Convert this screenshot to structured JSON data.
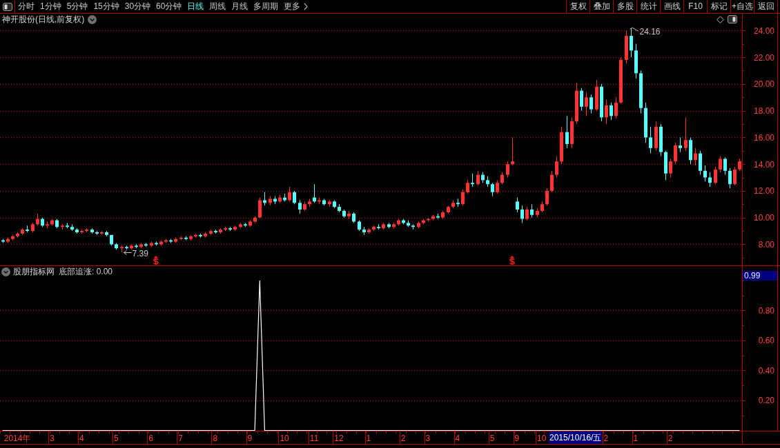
{
  "toolbar": {
    "period_tabs": [
      {
        "label": "分时",
        "selected": false
      },
      {
        "label": "1分钟",
        "selected": false
      },
      {
        "label": "5分钟",
        "selected": false
      },
      {
        "label": "15分钟",
        "selected": false
      },
      {
        "label": "30分钟",
        "selected": false
      },
      {
        "label": "60分钟",
        "selected": false
      },
      {
        "label": "日线",
        "selected": true
      },
      {
        "label": "周线",
        "selected": false
      },
      {
        "label": "月线",
        "selected": false
      },
      {
        "label": "多周期",
        "selected": false
      }
    ],
    "more_button": {
      "label": "更多"
    },
    "buttons": [
      "复权",
      "叠加",
      "多股",
      "统计",
      "画线",
      "F10",
      "标记",
      "+自选",
      "返回"
    ]
  },
  "chart": {
    "price_title": "神开股份(日线,前复权)",
    "indicator_name": "股朋指标网",
    "indicator_readout": "底部追涨: 0.00",
    "cursor_value": "0.99",
    "cursor_date": "2015/10/16/五",
    "chart_data": [
      {
        "type": "candlestick",
        "grid": true,
        "ylim": [
          6.45,
          24.4
        ],
        "yticks": [
          {
            "value": 8,
            "label": "8.00"
          },
          {
            "value": 10,
            "label": "10.00"
          },
          {
            "value": 12,
            "label": "12.00"
          },
          {
            "value": 14,
            "label": "14.00"
          },
          {
            "value": 16,
            "label": "16.00"
          },
          {
            "value": 18,
            "label": "18.00"
          },
          {
            "value": 20,
            "label": "20.00"
          },
          {
            "value": 22,
            "label": "22.00"
          },
          {
            "value": 24,
            "label": "24.00"
          }
        ],
        "ohlc": [
          [
            8.3,
            8.4,
            8.1,
            8.2
          ],
          [
            8.2,
            8.5,
            8.1,
            8.4
          ],
          [
            8.4,
            8.7,
            8.3,
            8.6
          ],
          [
            8.6,
            8.9,
            8.5,
            8.8
          ],
          [
            8.8,
            9.2,
            8.7,
            9.1
          ],
          [
            9.1,
            9.4,
            8.9,
            9.0
          ],
          [
            9.0,
            9.6,
            8.9,
            9.5
          ],
          [
            9.5,
            10.3,
            9.4,
            9.9
          ],
          [
            9.9,
            10.0,
            9.3,
            9.4
          ],
          [
            9.4,
            9.7,
            9.2,
            9.5
          ],
          [
            9.5,
            9.9,
            9.4,
            9.8
          ],
          [
            9.8,
            9.9,
            9.2,
            9.3
          ],
          [
            9.3,
            9.5,
            9.1,
            9.4
          ],
          [
            9.4,
            9.6,
            9.2,
            9.3
          ],
          [
            9.3,
            9.5,
            9.0,
            9.1
          ],
          [
            9.1,
            9.2,
            8.8,
            8.9
          ],
          [
            8.9,
            9.1,
            8.8,
            9.0
          ],
          [
            9.0,
            9.2,
            8.9,
            9.1
          ],
          [
            9.1,
            9.2,
            8.8,
            8.9
          ],
          [
            8.9,
            9.0,
            8.7,
            8.8
          ],
          [
            8.8,
            9.0,
            8.7,
            8.9
          ],
          [
            8.9,
            9.0,
            8.6,
            8.7
          ],
          [
            8.7,
            8.7,
            7.9,
            8.0
          ],
          [
            8.0,
            8.1,
            7.6,
            7.7
          ],
          [
            7.7,
            7.9,
            7.39,
            7.8
          ],
          [
            7.8,
            7.9,
            7.6,
            7.7
          ],
          [
            7.7,
            8.0,
            7.6,
            7.9
          ],
          [
            7.9,
            8.0,
            7.7,
            7.8
          ],
          [
            7.8,
            8.1,
            7.7,
            8.0
          ],
          [
            8.0,
            8.1,
            7.8,
            7.9
          ],
          [
            7.9,
            8.2,
            7.8,
            8.1
          ],
          [
            8.1,
            8.2,
            7.9,
            8.0
          ],
          [
            8.0,
            8.3,
            7.9,
            8.2
          ],
          [
            8.2,
            8.4,
            8.1,
            8.3
          ],
          [
            8.3,
            8.4,
            8.1,
            8.2
          ],
          [
            8.2,
            8.5,
            8.1,
            8.4
          ],
          [
            8.4,
            8.6,
            8.3,
            8.5
          ],
          [
            8.5,
            8.6,
            8.3,
            8.4
          ],
          [
            8.4,
            8.7,
            8.3,
            8.6
          ],
          [
            8.6,
            8.8,
            8.5,
            8.7
          ],
          [
            8.7,
            8.8,
            8.5,
            8.6
          ],
          [
            8.6,
            8.9,
            8.5,
            8.8
          ],
          [
            8.8,
            9.1,
            8.7,
            9.0
          ],
          [
            9.0,
            9.1,
            8.8,
            8.9
          ],
          [
            8.9,
            9.2,
            8.8,
            9.1
          ],
          [
            9.1,
            9.3,
            9.0,
            9.2
          ],
          [
            9.2,
            9.3,
            9.0,
            9.1
          ],
          [
            9.1,
            9.4,
            9.0,
            9.3
          ],
          [
            9.3,
            9.6,
            9.2,
            9.5
          ],
          [
            9.5,
            9.6,
            9.3,
            9.4
          ],
          [
            9.4,
            9.8,
            9.3,
            9.7
          ],
          [
            9.7,
            10.1,
            9.6,
            10.0
          ],
          [
            10.0,
            11.5,
            10.0,
            11.3
          ],
          [
            11.3,
            11.9,
            10.9,
            11.1
          ],
          [
            11.1,
            11.6,
            10.9,
            11.4
          ],
          [
            11.4,
            11.6,
            11.0,
            11.2
          ],
          [
            11.2,
            11.7,
            11.1,
            11.5
          ],
          [
            11.5,
            11.8,
            11.2,
            11.3
          ],
          [
            11.3,
            12.3,
            11.2,
            11.9
          ],
          [
            11.9,
            12.0,
            11.0,
            11.1
          ],
          [
            11.1,
            11.3,
            10.3,
            10.6
          ],
          [
            10.6,
            11.2,
            10.5,
            11.0
          ],
          [
            11.0,
            11.4,
            10.8,
            11.2
          ],
          [
            11.5,
            12.5,
            11.1,
            11.2
          ],
          [
            11.2,
            11.5,
            11.0,
            11.3
          ],
          [
            11.3,
            11.4,
            10.9,
            11.0
          ],
          [
            11.0,
            11.3,
            10.8,
            11.2
          ],
          [
            11.2,
            11.3,
            10.7,
            10.8
          ],
          [
            10.8,
            11.0,
            10.4,
            10.5
          ],
          [
            10.5,
            10.6,
            10.0,
            10.1
          ],
          [
            10.1,
            10.5,
            9.9,
            10.3
          ],
          [
            10.3,
            10.4,
            9.6,
            9.7
          ],
          [
            9.7,
            9.8,
            9.0,
            9.1
          ],
          [
            9.1,
            9.3,
            8.7,
            8.9
          ],
          [
            8.9,
            9.2,
            8.8,
            9.1
          ],
          [
            9.1,
            9.4,
            9.0,
            9.3
          ],
          [
            9.3,
            9.5,
            9.1,
            9.2
          ],
          [
            9.2,
            9.6,
            9.1,
            9.5
          ],
          [
            9.5,
            9.6,
            9.2,
            9.3
          ],
          [
            9.3,
            9.6,
            9.2,
            9.5
          ],
          [
            9.5,
            9.9,
            9.4,
            9.8
          ],
          [
            9.8,
            9.9,
            9.5,
            9.6
          ],
          [
            9.6,
            9.8,
            9.3,
            9.4
          ],
          [
            9.4,
            9.5,
            9.1,
            9.3
          ],
          [
            9.3,
            9.7,
            9.2,
            9.6
          ],
          [
            9.6,
            9.9,
            9.5,
            9.8
          ],
          [
            9.8,
            10.0,
            9.7,
            9.9
          ],
          [
            9.9,
            10.2,
            9.8,
            10.1
          ],
          [
            10.1,
            10.3,
            9.9,
            10.0
          ],
          [
            10.0,
            10.5,
            9.9,
            10.4
          ],
          [
            10.4,
            10.9,
            10.3,
            10.8
          ],
          [
            10.8,
            11.3,
            10.7,
            11.1
          ],
          [
            11.1,
            11.4,
            10.8,
            11.0
          ],
          [
            11.0,
            12.1,
            10.9,
            11.9
          ],
          [
            11.9,
            12.8,
            11.8,
            12.6
          ],
          [
            12.6,
            13.3,
            12.3,
            12.5
          ],
          [
            12.5,
            13.5,
            12.4,
            13.2
          ],
          [
            13.2,
            13.4,
            12.6,
            12.8
          ],
          [
            12.8,
            13.1,
            12.3,
            12.5
          ],
          [
            12.5,
            12.6,
            11.6,
            11.9
          ],
          [
            11.9,
            12.8,
            11.8,
            12.6
          ],
          [
            12.6,
            13.4,
            12.5,
            13.2
          ],
          [
            13.2,
            14.2,
            13.0,
            14.0
          ],
          [
            14.0,
            16.0,
            13.9,
            14.2
          ],
          [
            11.2,
            11.5,
            10.4,
            10.6
          ],
          [
            10.6,
            10.9,
            9.6,
            9.9
          ],
          [
            9.9,
            10.8,
            9.8,
            10.6
          ],
          [
            10.6,
            11.0,
            10.0,
            10.2
          ],
          [
            10.2,
            10.7,
            10.0,
            10.5
          ],
          [
            10.5,
            11.2,
            10.4,
            11.0
          ],
          [
            11.0,
            12.2,
            10.9,
            12.0
          ],
          [
            12.0,
            13.5,
            11.9,
            13.2
          ],
          [
            13.2,
            14.6,
            13.0,
            14.2
          ],
          [
            14.2,
            16.8,
            14.0,
            16.4
          ],
          [
            16.4,
            17.6,
            15.2,
            15.5
          ],
          [
            15.5,
            17.5,
            15.2,
            17.2
          ],
          [
            17.2,
            20.1,
            17.0,
            19.5
          ],
          [
            19.5,
            19.7,
            18.0,
            18.3
          ],
          [
            18.3,
            19.4,
            17.6,
            19.0
          ],
          [
            19.0,
            19.2,
            17.8,
            18.1
          ],
          [
            18.1,
            20.3,
            18.0,
            19.8
          ],
          [
            19.8,
            20.0,
            17.2,
            17.5
          ],
          [
            17.5,
            18.8,
            17.0,
            18.4
          ],
          [
            18.4,
            18.6,
            17.3,
            17.6
          ],
          [
            17.6,
            19.0,
            17.4,
            18.6
          ],
          [
            18.6,
            22.0,
            18.5,
            21.8
          ],
          [
            21.8,
            24.0,
            21.5,
            23.6
          ],
          [
            23.6,
            24.16,
            22.0,
            22.5
          ],
          [
            22.5,
            23.0,
            20.4,
            20.8
          ],
          [
            20.8,
            21.0,
            17.8,
            18.2
          ],
          [
            18.2,
            18.6,
            15.6,
            16.0
          ],
          [
            16.0,
            16.8,
            14.8,
            15.2
          ],
          [
            15.2,
            17.2,
            15.0,
            16.8
          ],
          [
            16.8,
            17.0,
            14.6,
            14.9
          ],
          [
            14.9,
            15.0,
            12.8,
            13.3
          ],
          [
            13.3,
            14.4,
            13.0,
            14.2
          ],
          [
            14.2,
            15.6,
            14.0,
            15.4
          ],
          [
            15.4,
            16.0,
            14.9,
            15.2
          ],
          [
            15.2,
            17.5,
            15.0,
            15.8
          ],
          [
            15.8,
            16.0,
            14.0,
            14.3
          ],
          [
            14.3,
            15.2,
            13.9,
            14.8
          ],
          [
            14.8,
            15.0,
            13.2,
            13.5
          ],
          [
            13.5,
            13.9,
            12.7,
            13.0
          ],
          [
            13.0,
            13.4,
            12.3,
            12.6
          ],
          [
            12.6,
            13.8,
            12.5,
            13.6
          ],
          [
            13.6,
            14.6,
            13.4,
            14.4
          ],
          [
            14.4,
            14.5,
            13.2,
            13.5
          ],
          [
            13.5,
            13.7,
            12.2,
            12.5
          ],
          [
            12.5,
            13.8,
            12.4,
            13.6
          ],
          [
            13.6,
            14.4,
            13.5,
            14.2
          ]
        ],
        "series": [
          {
            "type": "scatter",
            "color": "#ff2020",
            "values": [
              null,
              null,
              null,
              null,
              null,
              null,
              null,
              null,
              null,
              null,
              null,
              null,
              null,
              null,
              null,
              null,
              null,
              null,
              null,
              null,
              null,
              null,
              null,
              null,
              null,
              null,
              null,
              null,
              null,
              null,
              null,
              6.8,
              null,
              null,
              null,
              null,
              null,
              null,
              null,
              null,
              null,
              null,
              null,
              null,
              null,
              null,
              null,
              null,
              null,
              null,
              null,
              null,
              null,
              null,
              null,
              null,
              null,
              null,
              null,
              null,
              null,
              null,
              null,
              null,
              null,
              null,
              null,
              null,
              null,
              null,
              null,
              null,
              null,
              null,
              null,
              null,
              null,
              null,
              null,
              null,
              null,
              null,
              null,
              null,
              null,
              null,
              null,
              null,
              null,
              null,
              null,
              null,
              null,
              null,
              null,
              null,
              null,
              null,
              null,
              null,
              null,
              null,
              null,
              6.8,
              null,
              null,
              null,
              null,
              null,
              null,
              null,
              null,
              null,
              null,
              null,
              null,
              null,
              null,
              null,
              null,
              null,
              null,
              null,
              null,
              null,
              null,
              null,
              null,
              null,
              null,
              null,
              null,
              null,
              null,
              null,
              null,
              null,
              null,
              null,
              null,
              null,
              null,
              null,
              null,
              null,
              null,
              null,
              null,
              null,
              null
            ]
          }
        ],
        "annotations": [
          "24.16",
          "7.39"
        ]
      },
      {
        "type": "line",
        "grid": true,
        "color": "#ffffff",
        "ylim": [
          0,
          1.02
        ],
        "yticks": [
          {
            "value": 0.2,
            "label": "0.20"
          },
          {
            "value": 0.4,
            "label": "0.40"
          },
          {
            "value": 0.6,
            "label": "0.60"
          },
          {
            "value": 0.8,
            "label": "0.80"
          }
        ],
        "categories": [
          null,
          null,
          null,
          "2014年",
          null,
          null,
          null,
          null,
          null,
          null,
          "3",
          null,
          null,
          null,
          null,
          null,
          "4",
          null,
          null,
          null,
          null,
          null,
          null,
          "5",
          null,
          null,
          null,
          null,
          null,
          null,
          "6",
          null,
          null,
          null,
          null,
          null,
          "7",
          null,
          null,
          null,
          null,
          null,
          null,
          "8",
          null,
          null,
          null,
          null,
          null,
          null,
          "9",
          null,
          null,
          null,
          null,
          null,
          null,
          "10",
          null,
          null,
          null,
          null,
          null,
          "11",
          null,
          null,
          null,
          null,
          "12",
          null,
          null,
          null,
          null,
          null,
          "1",
          null,
          null,
          null,
          null,
          null,
          null,
          "2",
          null,
          null,
          null,
          null,
          "3",
          null,
          null,
          null,
          null,
          null,
          "4",
          null,
          null,
          null,
          null,
          null,
          null,
          "5",
          null,
          null,
          null,
          null,
          "9",
          null,
          null,
          null,
          null,
          "10",
          null,
          null,
          null,
          null,
          null,
          null,
          null,
          null,
          null,
          null,
          null,
          null,
          "2",
          null,
          null,
          null,
          null,
          null,
          "1",
          null,
          null,
          null,
          null,
          null,
          null,
          "2",
          null,
          null,
          null,
          null,
          null,
          null,
          null,
          null,
          null,
          null,
          null,
          null,
          null,
          null
        ],
        "values": [
          0,
          0,
          0,
          0,
          0,
          0,
          0,
          0,
          0,
          0,
          0,
          0,
          0,
          0,
          0,
          0,
          0,
          0,
          0,
          0,
          0,
          0,
          0,
          0,
          0,
          0,
          0,
          0,
          0,
          0,
          0,
          0,
          0,
          0,
          0,
          0,
          0,
          0,
          0,
          0,
          0,
          0,
          0,
          0,
          0,
          0,
          0,
          0,
          0,
          0,
          0,
          0,
          1,
          0,
          0,
          0,
          0,
          0,
          0,
          0,
          0,
          0,
          0,
          0,
          0,
          0,
          0,
          0,
          0,
          0,
          0,
          0,
          0,
          0,
          0,
          0,
          0,
          0,
          0,
          0,
          0,
          0,
          0,
          0,
          0,
          0,
          0,
          0,
          0,
          0,
          0,
          0,
          0,
          0,
          0,
          0,
          0,
          0,
          0,
          0,
          0,
          0,
          0,
          0,
          0,
          0,
          0,
          0,
          0,
          0,
          0,
          0,
          0,
          0,
          0,
          0,
          0,
          0,
          0,
          0,
          0,
          0,
          0,
          0,
          0,
          0,
          0,
          0,
          0,
          0,
          0,
          0,
          0,
          0,
          0,
          0,
          0,
          0,
          0,
          0,
          0,
          0,
          0,
          0,
          0,
          0,
          0,
          0,
          0,
          0
        ]
      }
    ]
  }
}
